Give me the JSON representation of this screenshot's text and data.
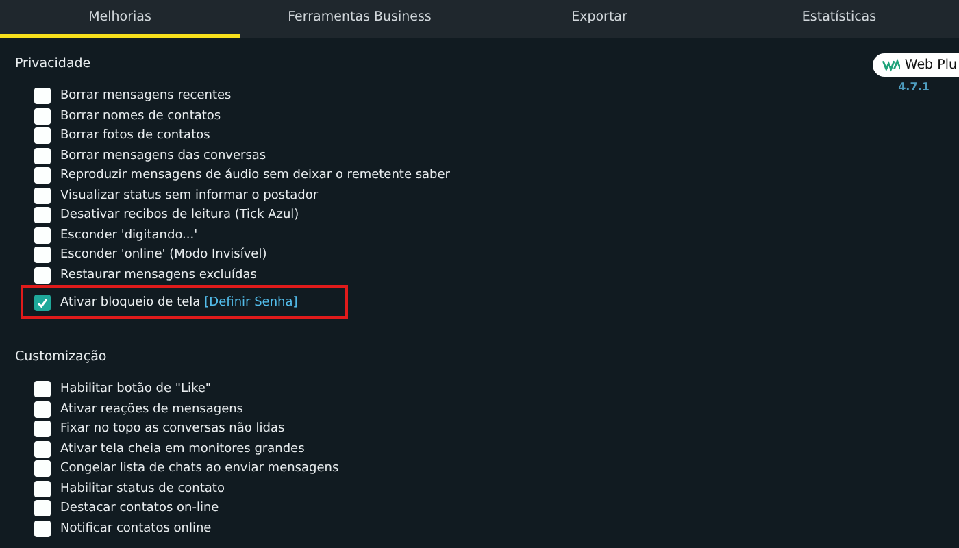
{
  "tabs": [
    {
      "label": "Melhorias",
      "selected": true
    },
    {
      "label": "Ferramentas Business",
      "selected": false
    },
    {
      "label": "Exportar",
      "selected": false
    },
    {
      "label": "Estatísticas",
      "selected": false
    }
  ],
  "badge": {
    "name": "Web Plu",
    "version": "4.7.1"
  },
  "sections": [
    {
      "title": "Privacidade",
      "items": [
        {
          "label": "Borrar mensagens recentes",
          "checked": false,
          "highlighted": false
        },
        {
          "label": "Borrar nomes de contatos",
          "checked": false,
          "highlighted": false
        },
        {
          "label": "Borrar fotos de contatos",
          "checked": false,
          "highlighted": false
        },
        {
          "label": "Borrar mensagens das conversas",
          "checked": false,
          "highlighted": false
        },
        {
          "label": "Reproduzir mensagens de áudio sem deixar o remetente saber",
          "checked": false,
          "highlighted": false
        },
        {
          "label": "Visualizar status sem informar o postador",
          "checked": false,
          "highlighted": false
        },
        {
          "label": "Desativar recibos de leitura (Tick Azul)",
          "checked": false,
          "highlighted": false
        },
        {
          "label": "Esconder 'digitando...'",
          "checked": false,
          "highlighted": false
        },
        {
          "label": "Esconder 'online' (Modo Invisível)",
          "checked": false,
          "highlighted": false
        },
        {
          "label": "Restaurar mensagens excluídas",
          "checked": false,
          "highlighted": false
        },
        {
          "label": "Ativar bloqueio de tela",
          "link": "[Definir Senha]",
          "checked": true,
          "highlighted": true
        }
      ]
    },
    {
      "title": "Customização",
      "items": [
        {
          "label": "Habilitar botão de \"Like\"",
          "checked": false,
          "highlighted": false
        },
        {
          "label": "Ativar reações de mensagens",
          "checked": false,
          "highlighted": false
        },
        {
          "label": "Fixar no topo as conversas não lidas",
          "checked": false,
          "highlighted": false
        },
        {
          "label": "Ativar tela cheia em monitores grandes",
          "checked": false,
          "highlighted": false
        },
        {
          "label": "Congelar lista de chats ao enviar mensagens",
          "checked": false,
          "highlighted": false
        },
        {
          "label": "Habilitar status de contato",
          "checked": false,
          "highlighted": false
        },
        {
          "label": "Destacar contatos on-line",
          "checked": false,
          "highlighted": false
        },
        {
          "label": "Notificar contatos online",
          "checked": false,
          "highlighted": false
        }
      ]
    }
  ]
}
